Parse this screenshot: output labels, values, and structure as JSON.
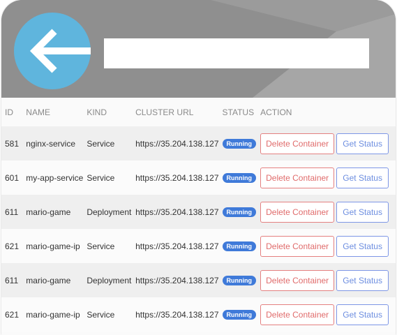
{
  "header": {
    "back_icon": "arrow-left-icon",
    "colors": {
      "header_bg": "#8f8f8f",
      "back_button": "#5fb5dd"
    }
  },
  "table": {
    "columns": [
      "ID",
      "NAME",
      "KIND",
      "CLUSTER URL",
      "STATUS",
      "ACTION"
    ],
    "rows": [
      {
        "id": "581",
        "name": "nginx-service",
        "kind": "Service",
        "url": "https://35.204.138.127",
        "status": "Running",
        "delete_label": "Delete Container",
        "status_label": "Get Status"
      },
      {
        "id": "601",
        "name": "my-app-service",
        "kind": "Service",
        "url": "https://35.204.138.127",
        "status": "Running",
        "delete_label": "Delete Container",
        "status_label": "Get Status"
      },
      {
        "id": "611",
        "name": "mario-game",
        "kind": "Deployment",
        "url": "https://35.204.138.127",
        "status": "Running",
        "delete_label": "Delete Container",
        "status_label": "Get Status"
      },
      {
        "id": "621",
        "name": "mario-game-ip",
        "kind": "Service",
        "url": "https://35.204.138.127",
        "status": "Running",
        "delete_label": "Delete Container",
        "status_label": "Get Status"
      },
      {
        "id": "611",
        "name": "mario-game",
        "kind": "Deployment",
        "url": "https://35.204.138.127",
        "status": "Running",
        "delete_label": "Delete Container",
        "status_label": "Get Status"
      },
      {
        "id": "621",
        "name": "mario-game-ip",
        "kind": "Service",
        "url": "https://35.204.138.127",
        "status": "Running",
        "delete_label": "Delete Container",
        "status_label": "Get Status"
      }
    ],
    "colors": {
      "badge": "#3f7ad9",
      "delete": "#e06b6b",
      "status": "#6d8ee0"
    }
  }
}
